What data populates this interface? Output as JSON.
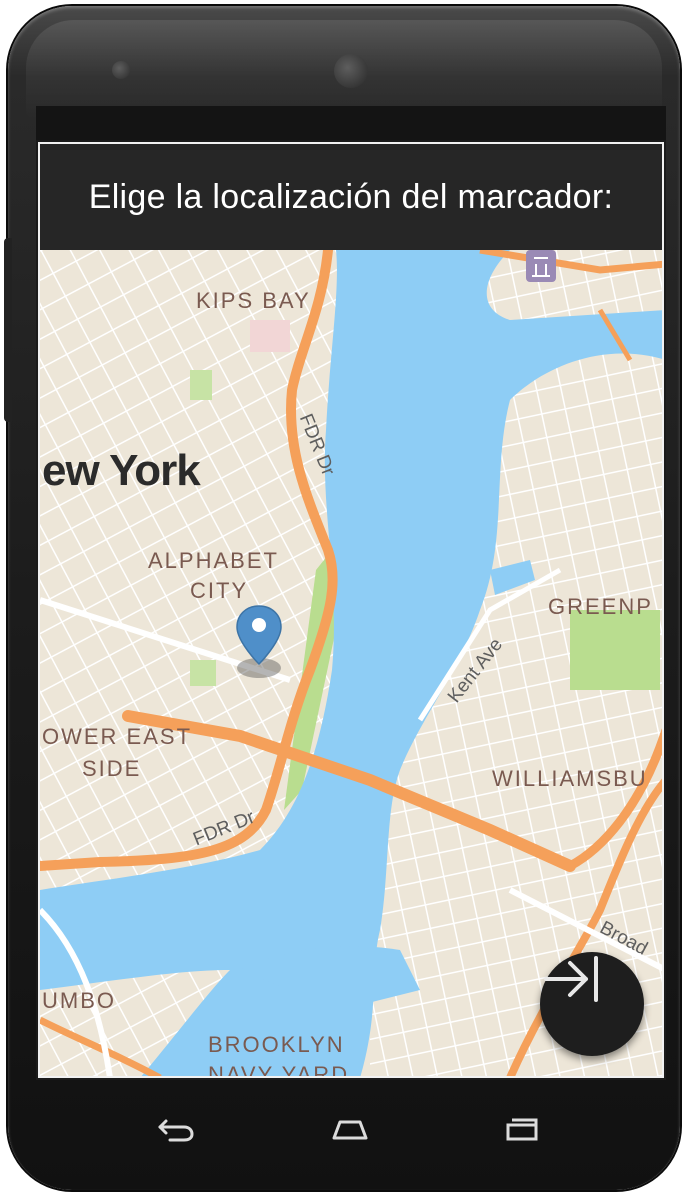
{
  "header": {
    "title": "Elige la localización del marcador:"
  },
  "map": {
    "city_label": "ew York",
    "neighborhoods": [
      {
        "name": "kips-bay",
        "text": "KIPS BAY"
      },
      {
        "name": "alphabet-city-1",
        "text": "ALPHABET"
      },
      {
        "name": "alphabet-city-2",
        "text": "CITY"
      },
      {
        "name": "greenpoint",
        "text": "GREENP"
      },
      {
        "name": "lower-east-side-1",
        "text": "OWER EAST"
      },
      {
        "name": "lower-east-side-2",
        "text": "SIDE"
      },
      {
        "name": "williamsburg",
        "text": "WILLIAMSBU"
      },
      {
        "name": "dumbo",
        "text": "UMBO"
      },
      {
        "name": "brooklyn-navy-yard-1",
        "text": "BROOKLYN"
      },
      {
        "name": "brooklyn-navy-yard-2",
        "text": "NAVY YARD"
      }
    ],
    "roads": {
      "fdr_upper": "FDR Dr",
      "fdr_lower": "FDR Dr",
      "kent_ave": "Kent Ave",
      "broadway": "Broad"
    },
    "colors": {
      "land": "#ede6d8",
      "water": "#8ecdf5",
      "park": "#b9dd8f",
      "highway": "#f5a05a",
      "street": "#ffffff",
      "pin": "#4f8fc9"
    },
    "marker_icon": "map-pin-icon"
  },
  "fab": {
    "icon": "arrow-right-to-bar-icon"
  },
  "nav": {
    "back_icon": "back-arrow-icon",
    "home_icon": "home-icon",
    "recents_icon": "recent-apps-icon"
  }
}
